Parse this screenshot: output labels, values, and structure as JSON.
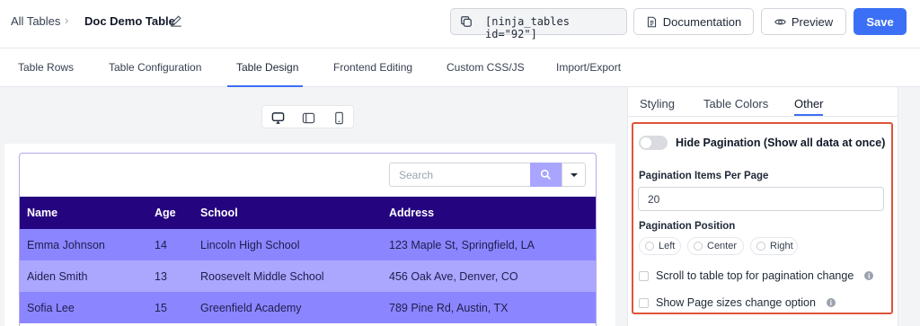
{
  "breadcrumb": {
    "all_tables": "All Tables",
    "separator": "›",
    "table_title": "Doc Demo Table"
  },
  "header": {
    "shortcode": "[ninja_tables id=\"92\"]",
    "documentation_label": "Documentation",
    "preview_label": "Preview",
    "save_label": "Save",
    "save_color": "#3b6ff5"
  },
  "tabs": [
    {
      "label": "Table Rows"
    },
    {
      "label": "Table Configuration"
    },
    {
      "label": "Table Design",
      "active": true
    },
    {
      "label": "Frontend Editing"
    },
    {
      "label": "Custom CSS/JS"
    },
    {
      "label": "Import/Export"
    }
  ],
  "device_switch": [
    "desktop-icon",
    "tablet-icon",
    "mobile-icon"
  ],
  "preview_table": {
    "search_placeholder": "Search",
    "header_color": "#25047f",
    "row_colors": [
      "#8b86ff",
      "#aba7ff"
    ],
    "columns": [
      "Name",
      "Age",
      "School",
      "Address"
    ],
    "rows": [
      [
        "Emma Johnson",
        "14",
        "Lincoln High School",
        "123 Maple St, Springfield, LA"
      ],
      [
        "Aiden Smith",
        "13",
        "Roosevelt Middle School",
        "456 Oak Ave, Denver, CO"
      ],
      [
        "Sofia Lee",
        "15",
        "Greenfield Academy",
        "789 Pine Rd, Austin, TX"
      ]
    ]
  },
  "settings_panel": {
    "tabs": [
      {
        "label": "Styling"
      },
      {
        "label": "Table Colors"
      },
      {
        "label": "Other",
        "active": true
      }
    ],
    "hide_pagination_label": "Hide Pagination (Show all data at once)",
    "hide_pagination_enabled": false,
    "items_per_page_label": "Pagination Items Per Page",
    "items_per_page_value": "20",
    "position_label": "Pagination Position",
    "position_options": [
      "Left",
      "Center",
      "Right"
    ],
    "scroll_to_top_label": "Scroll to table top for pagination change",
    "page_sizes_label": "Show Page sizes change option",
    "highlight_color": "#e0533a"
  }
}
